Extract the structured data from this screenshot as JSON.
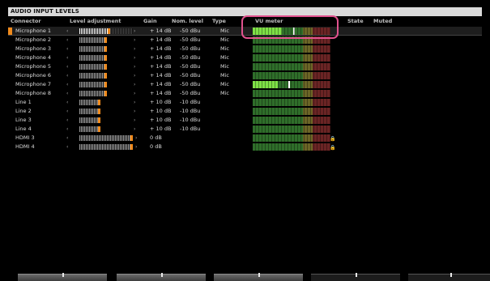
{
  "title": "AUDIO INPUT LEVELS",
  "headers": {
    "connector": "Connector",
    "level_adjustment": "Level adjustment",
    "gain": "Gain",
    "nom_level": "Nom. level",
    "type": "Type",
    "vu_meter": "VU meter",
    "state": "State",
    "muted": "Muted"
  },
  "arrows": {
    "left": "‹",
    "right": "›"
  },
  "rows": [
    {
      "connector": "Microphone 1",
      "gain": "+ 14 dB",
      "nom": "-50 dBu",
      "type": "Mic",
      "level": 0.58,
      "vu": 0.38,
      "peak": 0.52,
      "clip": ""
    },
    {
      "connector": "Microphone 2",
      "gain": "+ 14 dB",
      "nom": "-50 dBu",
      "type": "Mic",
      "level": 0.52,
      "vu": 0,
      "peak": 0,
      "clip": ""
    },
    {
      "connector": "Microphone 3",
      "gain": "+ 14 dB",
      "nom": "-50 dBu",
      "type": "Mic",
      "level": 0.52,
      "vu": 0,
      "peak": 0,
      "clip": ""
    },
    {
      "connector": "Microphone 4",
      "gain": "+ 14 dB",
      "nom": "-50 dBu",
      "type": "Mic",
      "level": 0.52,
      "vu": 0,
      "peak": 0,
      "clip": ""
    },
    {
      "connector": "Microphone 5",
      "gain": "+ 14 dB",
      "nom": "-50 dBu",
      "type": "Mic",
      "level": 0.52,
      "vu": 0,
      "peak": 0,
      "clip": ""
    },
    {
      "connector": "Microphone 6",
      "gain": "+ 14 dB",
      "nom": "-50 dBu",
      "type": "Mic",
      "level": 0.52,
      "vu": 0,
      "peak": 0,
      "clip": ""
    },
    {
      "connector": "Microphone 7",
      "gain": "+ 14 dB",
      "nom": "-50 dBu",
      "type": "Mic",
      "level": 0.52,
      "vu": 0.32,
      "peak": 0.46,
      "clip": ""
    },
    {
      "connector": "Microphone 8",
      "gain": "+ 14 dB",
      "nom": "-50 dBu",
      "type": "Mic",
      "level": 0.52,
      "vu": 0,
      "peak": 0,
      "clip": ""
    },
    {
      "connector": "Line 1",
      "gain": "+ 10 dB",
      "nom": "-10 dBu",
      "type": "",
      "level": 0.4,
      "vu": 0,
      "peak": 0,
      "clip": ""
    },
    {
      "connector": "Line 2",
      "gain": "+ 10 dB",
      "nom": "-10 dBu",
      "type": "",
      "level": 0.4,
      "vu": 0,
      "peak": 0,
      "clip": ""
    },
    {
      "connector": "Line 3",
      "gain": "+ 10 dB",
      "nom": "-10 dBu",
      "type": "",
      "level": 0.4,
      "vu": 0,
      "peak": 0,
      "clip": ""
    },
    {
      "connector": "Line 4",
      "gain": "+ 10 dB",
      "nom": "-10 dBu",
      "type": "",
      "level": 0.4,
      "vu": 0,
      "peak": 0,
      "clip": ""
    },
    {
      "connector": "HDMI 3",
      "gain": "0 dB",
      "nom": "",
      "type": "",
      "level": 1.0,
      "vu": 0,
      "peak": 0,
      "clip": "🔒"
    },
    {
      "connector": "HDMI 4",
      "gain": "0 dB",
      "nom": "",
      "type": "",
      "level": 1.0,
      "vu": 0,
      "peak": 0,
      "clip": "🔒"
    }
  ],
  "colors": {
    "accent": "#f08a1c",
    "highlight": "#e0528e",
    "vu_green": "#2f6e2a",
    "vu_lit": "#7ee046",
    "vu_yellow": "#6b6526",
    "vu_red": "#6a2424"
  }
}
